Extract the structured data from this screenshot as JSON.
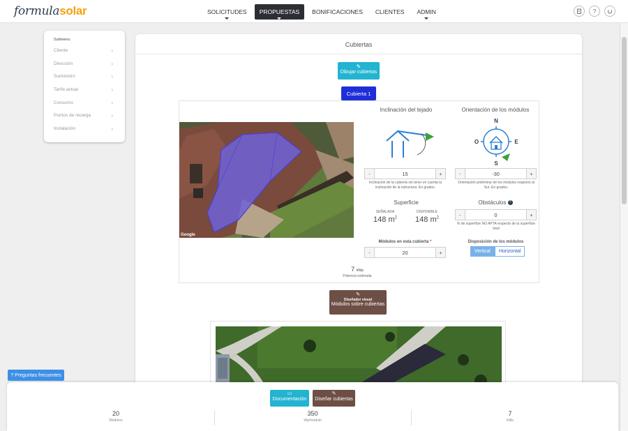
{
  "brand": {
    "part1": "formula",
    "part2": "solar"
  },
  "nav": {
    "items": [
      {
        "label": "SOLICITUDES"
      },
      {
        "label": "PROPUESTAS"
      },
      {
        "label": "BONIFICACIONES"
      },
      {
        "label": "CLIENTES"
      },
      {
        "label": "ADMIN"
      }
    ],
    "active": "PROPUESTAS"
  },
  "top_icons": [
    "building-icon",
    "help-icon",
    "power-icon"
  ],
  "submenu": {
    "title": "Submenu",
    "items": [
      {
        "label": "Cliente"
      },
      {
        "label": "Dirección"
      },
      {
        "label": "Suministro"
      },
      {
        "label": "Tarifa actual"
      },
      {
        "label": "Consumo"
      },
      {
        "label": "Puntos de recarga"
      },
      {
        "label": "Instalación"
      }
    ]
  },
  "main": {
    "title": "Cubiertas",
    "draw_button": "Dibujar cubiertas",
    "tab": "Cubierta 1"
  },
  "roof": {
    "inclination": {
      "title": "Inclinación del tejado",
      "value": "15",
      "note": "Inclinación de la cubierta sin tener en cuenta la inclinación de la estructura. En grados."
    },
    "orientation": {
      "title": "Orientación de los módulos",
      "compass": {
        "n": "N",
        "s": "S",
        "e": "E",
        "o": "O"
      },
      "value": "-30",
      "note": "Orientación preliminar de los módulos respecto al Sur. En grados."
    },
    "surface": {
      "title": "Superficie",
      "marked_label": "SEÑALADA",
      "marked_value": "148 m",
      "available_label": "DISPONIBLE",
      "available_value": "148 m",
      "unit_sup": "2"
    },
    "obstacles": {
      "title": "Obstáculos",
      "help": "?",
      "value": "0",
      "note": "% de superficie NO APTA respecto de la superficie total"
    },
    "modules": {
      "title": "Módulos en esta cubierta",
      "required": "*",
      "value": "20"
    },
    "layout": {
      "title": "Disposición de los módulos",
      "options": [
        "Vertical",
        "Horizontal"
      ],
      "selected": "Vertical"
    },
    "power": {
      "value": "7",
      "unit": "kWp",
      "label": "Potencia estimada"
    },
    "map_attribution": "Google"
  },
  "visual_designer": {
    "line1": "Diseñador visual",
    "line2": "Módulos sobre cubiertas"
  },
  "footer": {
    "doc_button": "Documentación",
    "design_button": "Diseñar cubiertas",
    "stats": [
      {
        "value": "20",
        "unit": "Módulos"
      },
      {
        "value": "350",
        "unit": "Wp/módulo"
      },
      {
        "value": "7",
        "unit": "kWp"
      }
    ]
  },
  "faq_button": "Preguntas frecuentes",
  "colors": {
    "accent_cyan": "#22b4d0",
    "accent_brown": "#6d4f45",
    "tab_blue": "#1f2fd8",
    "toggle_blue": "#7ab0e8",
    "faq_blue": "#3d8fe6",
    "brand_orange": "#f6a20b"
  }
}
